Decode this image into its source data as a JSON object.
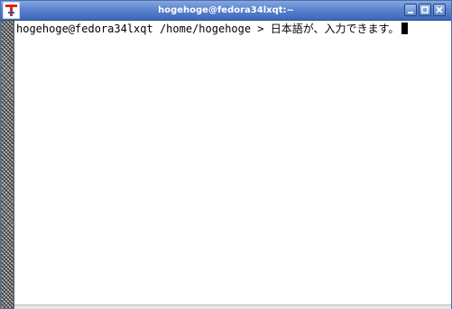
{
  "window": {
    "title": "hogehoge@fedora34lxqt:~",
    "icon": "terminal-app-icon",
    "buttons": [
      "minimize-icon",
      "maximize-icon",
      "close-icon"
    ]
  },
  "terminal": {
    "prompt": "hogehoge@fedora34lxqt /home/hogehoge > ",
    "input": "日本語が、入力できます。"
  },
  "colors": {
    "titlebar": "#5b83cf",
    "title_text": "#ffffff",
    "terminal_bg": "#ffffff",
    "terminal_fg": "#000000"
  }
}
